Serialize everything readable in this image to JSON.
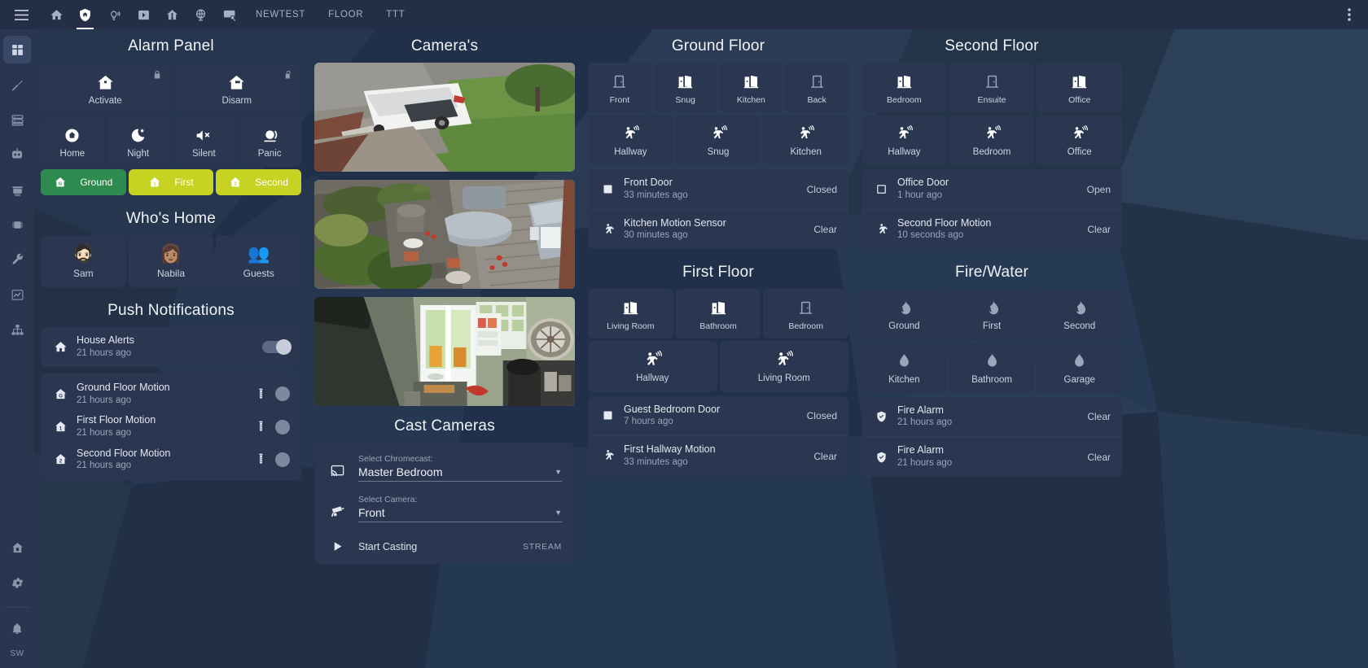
{
  "topbar": {
    "menu_icon": "hamburger-menu-icon",
    "overflow_icon": "more-vertical-icon",
    "tabs": [
      {
        "id": "home",
        "icon": "house-icon",
        "label": "",
        "active": false
      },
      {
        "id": "security",
        "icon": "shield-home-icon",
        "label": "",
        "active": true
      },
      {
        "id": "lights",
        "icon": "lightbulb-group-icon",
        "label": "",
        "active": false
      },
      {
        "id": "media",
        "icon": "media-play-box-icon",
        "label": "",
        "active": false
      },
      {
        "id": "climate",
        "icon": "home-thermometer-icon",
        "label": "",
        "active": false
      },
      {
        "id": "network",
        "icon": "globe-icon",
        "label": "",
        "active": false
      },
      {
        "id": "logbook",
        "icon": "text-search-icon",
        "label": "",
        "active": false
      },
      {
        "id": "newtest",
        "icon": "",
        "label": "NEWTEST",
        "active": false
      },
      {
        "id": "floor",
        "icon": "",
        "label": "FLOOR",
        "active": false
      },
      {
        "id": "ttt",
        "icon": "",
        "label": "TTT",
        "active": false
      }
    ]
  },
  "sidebar": {
    "items": [
      {
        "id": "overview",
        "icon": "dashboard-grid-icon",
        "active": true
      },
      {
        "id": "developer",
        "icon": "hammer-icon",
        "active": false
      },
      {
        "id": "servers",
        "icon": "server-icon",
        "active": false
      },
      {
        "id": "automation",
        "icon": "robot-icon",
        "active": false
      },
      {
        "id": "hacs",
        "icon": "hacs-store-icon",
        "active": false
      },
      {
        "id": "esphome",
        "icon": "chip-icon",
        "active": false
      },
      {
        "id": "tools",
        "icon": "wrench-icon",
        "active": false
      },
      {
        "id": "history",
        "icon": "chart-line-icon",
        "active": false
      },
      {
        "id": "integrations",
        "icon": "sitemap-icon",
        "active": false
      }
    ],
    "bottom_items": [
      {
        "id": "floorplan",
        "icon": "home-floor-icon"
      },
      {
        "id": "settings",
        "icon": "gear-icon"
      },
      {
        "id": "notifications",
        "icon": "bell-icon"
      }
    ],
    "user_initials": "SW"
  },
  "columns": {
    "alarm": {
      "title": "Alarm Panel",
      "modes_primary": [
        {
          "label": "Activate",
          "icon": "home-lock-icon",
          "lock_icon": "lock-closed-icon"
        },
        {
          "label": "Disarm",
          "icon": "home-unlock-icon",
          "lock_icon": "lock-open-icon"
        }
      ],
      "modes_secondary": [
        {
          "label": "Home",
          "icon": "home-circle-icon"
        },
        {
          "label": "Night",
          "icon": "moon-star-icon"
        },
        {
          "label": "Silent",
          "icon": "volume-mute-icon"
        },
        {
          "label": "Panic",
          "icon": "alarm-light-icon"
        }
      ],
      "floors": [
        {
          "label": "Ground",
          "icon": "home-floor-g-icon",
          "color": "#2e8a4e",
          "text_color": "#ffffff"
        },
        {
          "label": "First",
          "icon": "home-floor-1-icon",
          "color": "#c7d323",
          "text_color": "#ffffff"
        },
        {
          "label": "Second",
          "icon": "home-floor-2-icon",
          "color": "#c7d323",
          "text_color": "#ffffff"
        }
      ]
    },
    "whos_home": {
      "title": "Who's Home",
      "people": [
        {
          "name": "Sam",
          "avatar": "🧔🏻"
        },
        {
          "name": "Nabila",
          "avatar": "👩🏽"
        },
        {
          "name": "Guests",
          "avatar": "👥"
        }
      ]
    },
    "push": {
      "title": "Push Notifications",
      "main": {
        "name": "House Alerts",
        "time": "21 hours ago",
        "icon": "house-icon",
        "toggle_on": true
      },
      "items": [
        {
          "name": "Ground Floor Motion",
          "time": "21 hours ago",
          "icon": "home-floor-g-icon",
          "vial_icon": "test-tube-icon",
          "toggle_on": false
        },
        {
          "name": "First Floor Motion",
          "time": "21 hours ago",
          "icon": "home-floor-1-icon",
          "vial_icon": "test-tube-icon",
          "toggle_on": false
        },
        {
          "name": "Second Floor Motion",
          "time": "21 hours ago",
          "icon": "home-floor-2-icon",
          "vial_icon": "test-tube-icon",
          "toggle_on": false
        }
      ]
    },
    "cameras": {
      "title": "Camera's",
      "feeds": [
        {
          "id": "front-camera",
          "scene": "driveway"
        },
        {
          "id": "back-camera",
          "scene": "garden"
        },
        {
          "id": "kitchen-camera",
          "scene": "kitchen"
        }
      ]
    },
    "cast": {
      "title": "Cast Cameras",
      "chromecast": {
        "label": "Select Chromecast:",
        "value": "Master Bedroom",
        "icon": "cast-icon"
      },
      "camera": {
        "label": "Select Camera:",
        "value": "Front",
        "icon": "cctv-icon"
      },
      "action": {
        "label": "Start Casting",
        "badge": "STREAM",
        "icon": "play-icon"
      }
    },
    "ground": {
      "title": "Ground Floor",
      "doors": [
        {
          "label": "Front",
          "icon": "door-closed-icon",
          "open": false
        },
        {
          "label": "Snug",
          "icon": "door-open-icon",
          "open": true
        },
        {
          "label": "Kitchen",
          "icon": "door-open-icon",
          "open": true
        },
        {
          "label": "Back",
          "icon": "door-closed-icon",
          "open": false
        }
      ],
      "motions": [
        {
          "label": "Hallway",
          "icon": "motion-sensor-icon"
        },
        {
          "label": "Snug",
          "icon": "motion-sensor-icon"
        },
        {
          "label": "Kitchen",
          "icon": "motion-sensor-icon"
        }
      ],
      "status": [
        {
          "name": "Front Door",
          "time": "33 minutes ago",
          "state": "Closed",
          "icon": "square-filled-icon"
        },
        {
          "name": "Kitchen Motion Sensor",
          "time": "30 minutes ago",
          "state": "Clear",
          "icon": "walk-icon"
        }
      ]
    },
    "first": {
      "title": "First Floor",
      "doors": [
        {
          "label": "Living Room",
          "icon": "door-open-icon",
          "open": true
        },
        {
          "label": "Bathroom",
          "icon": "door-open-icon",
          "open": true
        },
        {
          "label": "Bedroom",
          "icon": "door-closed-icon",
          "open": false
        }
      ],
      "motions": [
        {
          "label": "Hallway",
          "icon": "motion-sensor-icon"
        },
        {
          "label": "Living Room",
          "icon": "motion-sensor-icon"
        }
      ],
      "status": [
        {
          "name": "Guest Bedroom Door",
          "time": "7 hours ago",
          "state": "Closed",
          "icon": "square-filled-icon"
        },
        {
          "name": "First Hallway Motion",
          "time": "33 minutes ago",
          "state": "Clear",
          "icon": "walk-icon"
        }
      ]
    },
    "second": {
      "title": "Second Floor",
      "doors": [
        {
          "label": "Bedroom",
          "icon": "door-open-icon",
          "open": true
        },
        {
          "label": "Ensuite",
          "icon": "door-closed-icon",
          "open": false
        },
        {
          "label": "Office",
          "icon": "door-open-icon",
          "open": true
        }
      ],
      "motions": [
        {
          "label": "Hallway",
          "icon": "motion-sensor-icon"
        },
        {
          "label": "Bedroom",
          "icon": "motion-sensor-icon"
        },
        {
          "label": "Office",
          "icon": "motion-sensor-icon"
        }
      ],
      "status": [
        {
          "name": "Office Door",
          "time": "1 hour ago",
          "state": "Open",
          "icon": "square-outline-icon"
        },
        {
          "name": "Second Floor Motion",
          "time": "10 seconds ago",
          "state": "Clear",
          "icon": "walk-icon"
        }
      ]
    },
    "firewater": {
      "title": "Fire/Water",
      "fire": [
        {
          "label": "Ground",
          "icon": "fire-icon"
        },
        {
          "label": "First",
          "icon": "fire-icon"
        },
        {
          "label": "Second",
          "icon": "fire-icon"
        }
      ],
      "water": [
        {
          "label": "Kitchen",
          "icon": "water-drop-icon"
        },
        {
          "label": "Bathroom",
          "icon": "water-drop-icon"
        },
        {
          "label": "Garage",
          "icon": "water-drop-icon"
        }
      ],
      "status": [
        {
          "name": "Fire Alarm",
          "time": "21 hours ago",
          "state": "Clear",
          "icon": "shield-check-icon"
        },
        {
          "name": "Fire Alarm",
          "time": "21 hours ago",
          "state": "Clear",
          "icon": "shield-check-icon"
        }
      ]
    }
  },
  "colors": {
    "background": "#23324c",
    "card": "#2b3751",
    "topbar": "#242f47",
    "sidebar": "#2a3550",
    "accent_green": "#2e8a4e",
    "accent_lime": "#c7d323",
    "text_primary": "#e8eaf0",
    "text_secondary": "#9aa5ba"
  }
}
